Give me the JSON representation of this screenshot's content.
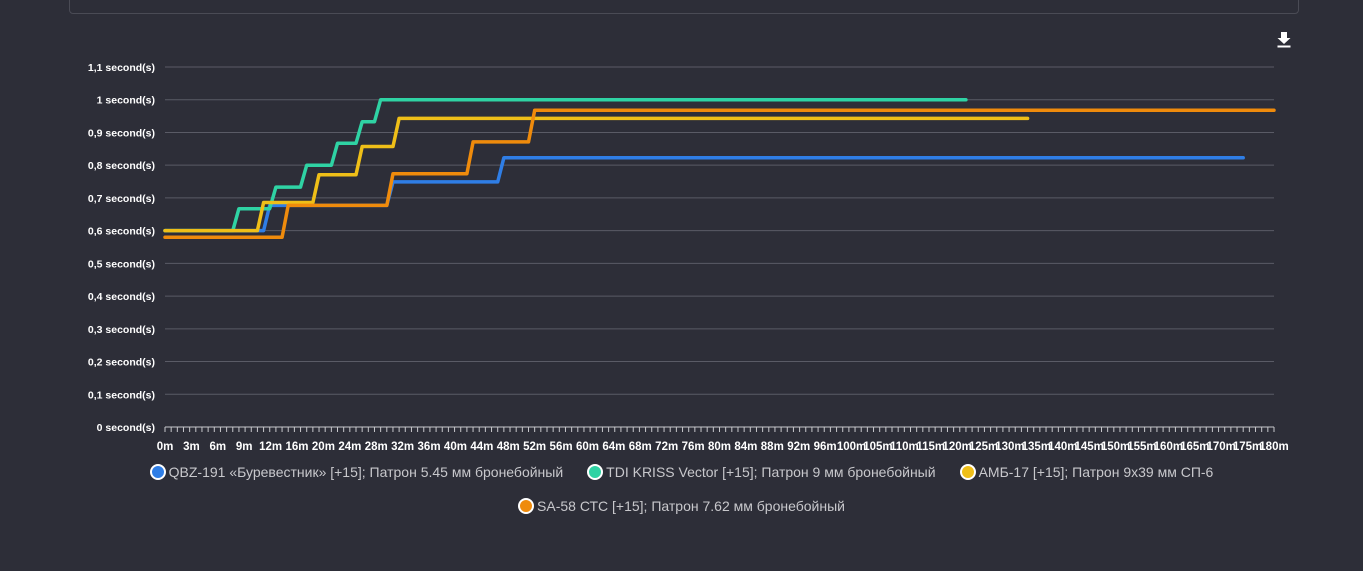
{
  "chart_data": {
    "type": "line",
    "y_unit": " second(s)",
    "y_ticks": [
      0,
      0.1,
      0.2,
      0.3,
      0.4,
      0.5,
      0.6,
      0.7,
      0.8,
      0.9,
      1,
      1.1
    ],
    "y_tick_labels": [
      "0 second(s)",
      "0,1 second(s)",
      "0,2 second(s)",
      "0,3 second(s)",
      "0,4 second(s)",
      "0,5 second(s)",
      "0,6 second(s)",
      "0,7 second(s)",
      "0,8 second(s)",
      "0,9 second(s)",
      "1 second(s)",
      "1,1 second(s)"
    ],
    "ylim": [
      0,
      1.1
    ],
    "x_tick_labels": [
      "0m",
      "3m",
      "6m",
      "9m",
      "12m",
      "16m",
      "20m",
      "24m",
      "28m",
      "32m",
      "36m",
      "40m",
      "44m",
      "48m",
      "52m",
      "56m",
      "60m",
      "64m",
      "68m",
      "72m",
      "76m",
      "80m",
      "84m",
      "88m",
      "92m",
      "96m",
      "100m",
      "105m",
      "110m",
      "115m",
      "120m",
      "125m",
      "130m",
      "135m",
      "140m",
      "145m",
      "150m",
      "155m",
      "160m",
      "165m",
      "170m",
      "175m",
      "180m"
    ],
    "grid": true,
    "legend_position": "bottom",
    "series": [
      {
        "name": "QBZ-191 «Буревестник» [+15]; Патрон 5.45 мм бронебойный",
        "color": "#2f7ee6",
        "points": [
          [
            0,
            0.6
          ],
          [
            16,
            0.6
          ],
          [
            17,
            0.677
          ],
          [
            36,
            0.677
          ],
          [
            37,
            0.749
          ],
          [
            54,
            0.749
          ],
          [
            55,
            0.823
          ],
          [
            175,
            0.823
          ]
        ]
      },
      {
        "name": "TDI KRISS Vector [+15]; Патрон 9 мм бронебойный",
        "color": "#2fd3a4",
        "points": [
          [
            0,
            0.6
          ],
          [
            11,
            0.6
          ],
          [
            12,
            0.667
          ],
          [
            17,
            0.667
          ],
          [
            18,
            0.733
          ],
          [
            22,
            0.733
          ],
          [
            23,
            0.8
          ],
          [
            27,
            0.8
          ],
          [
            28,
            0.867
          ],
          [
            31,
            0.867
          ],
          [
            32,
            0.933
          ],
          [
            34,
            0.933
          ],
          [
            35,
            1.0
          ],
          [
            130,
            1.0
          ]
        ]
      },
      {
        "name": "АМБ-17 [+15]; Патрон 9х39 мм СП-6",
        "color": "#efbf18",
        "points": [
          [
            0,
            0.6
          ],
          [
            15,
            0.6
          ],
          [
            16,
            0.686
          ],
          [
            24,
            0.686
          ],
          [
            25,
            0.771
          ],
          [
            31,
            0.771
          ],
          [
            32,
            0.857
          ],
          [
            37,
            0.857
          ],
          [
            38,
            0.943
          ],
          [
            140,
            0.943
          ]
        ]
      },
      {
        "name": "SA-58 СТС [+15]; Патрон 7.62 мм бронебойный",
        "color": "#ef8b0c",
        "points": [
          [
            0,
            0.58
          ],
          [
            19,
            0.58
          ],
          [
            20,
            0.677
          ],
          [
            36,
            0.677
          ],
          [
            37,
            0.774
          ],
          [
            49,
            0.774
          ],
          [
            50,
            0.871
          ],
          [
            59,
            0.871
          ],
          [
            60,
            0.968
          ],
          [
            180,
            0.968
          ]
        ]
      }
    ]
  },
  "toolbar": {
    "download_icon": "download-icon"
  }
}
